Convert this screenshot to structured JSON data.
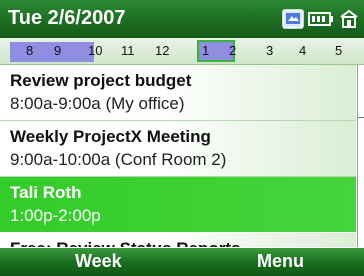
{
  "header": {
    "date": "Tue 2/6/2007",
    "status_icons": [
      "calendar-sync-icon",
      "battery-icon",
      "connection-icon"
    ]
  },
  "timeline": {
    "hours": [
      "8",
      "9",
      "10",
      "11",
      "12",
      "1",
      "2",
      "3",
      "4",
      "5"
    ],
    "current_hour": "1"
  },
  "appointments": [
    {
      "title": "Review project budget",
      "subtitle": "8:00a-9:00a (My office)"
    },
    {
      "title": "Weekly ProjectX Meeting",
      "subtitle": "9:00a-10:00a (Conf Room 2)"
    },
    {
      "title": "Tali Roth",
      "subtitle": "1:00p-2:00p",
      "selected": true
    },
    {
      "title": "Free: Review Status Reports",
      "subtitle": ""
    }
  ],
  "softkeys": {
    "left": "Week",
    "right": "Menu"
  },
  "colors": {
    "accent": "#1d6d22",
    "selected": "#3cd033",
    "busy_block": "#8f8ee0"
  }
}
